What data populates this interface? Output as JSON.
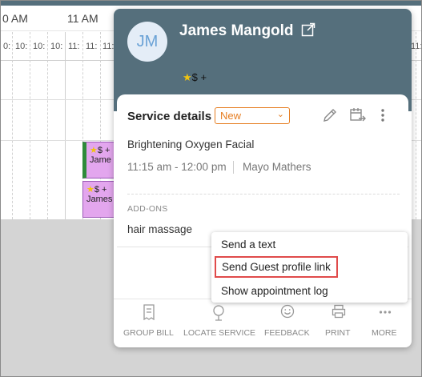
{
  "calendar": {
    "hours": [
      "0 AM",
      "11 AM"
    ],
    "minute_labels": [
      "0:",
      "10:",
      "10:",
      "10:",
      "11:",
      "11:",
      "11:",
      "11:"
    ],
    "appointments": [
      {
        "badges": "$ +",
        "name": "Jame"
      },
      {
        "badges": "$ +",
        "name": "James"
      }
    ]
  },
  "guest": {
    "initials": "JM",
    "name": "James Mangold",
    "badges": "$ +"
  },
  "service": {
    "title": "Service details",
    "status": "New",
    "name": "Brightening Oxygen Facial",
    "time": "11:15 am - 12:00 pm",
    "staff": "Mayo Mathers",
    "addons_label": "ADD-ONS",
    "addons": [
      "hair massage"
    ]
  },
  "menu": {
    "items": [
      "Send a text",
      "Send Guest profile link",
      "Show appointment log"
    ]
  },
  "toolbar": {
    "items": [
      "GROUP BILL",
      "LOCATE SERVICE",
      "FEEDBACK",
      "PRINT",
      "MORE"
    ]
  },
  "colors": {
    "header": "#556f7c",
    "accent": "#e67e22",
    "highlight_border": "#e04b4b",
    "appointment": "#e3a6ee"
  }
}
